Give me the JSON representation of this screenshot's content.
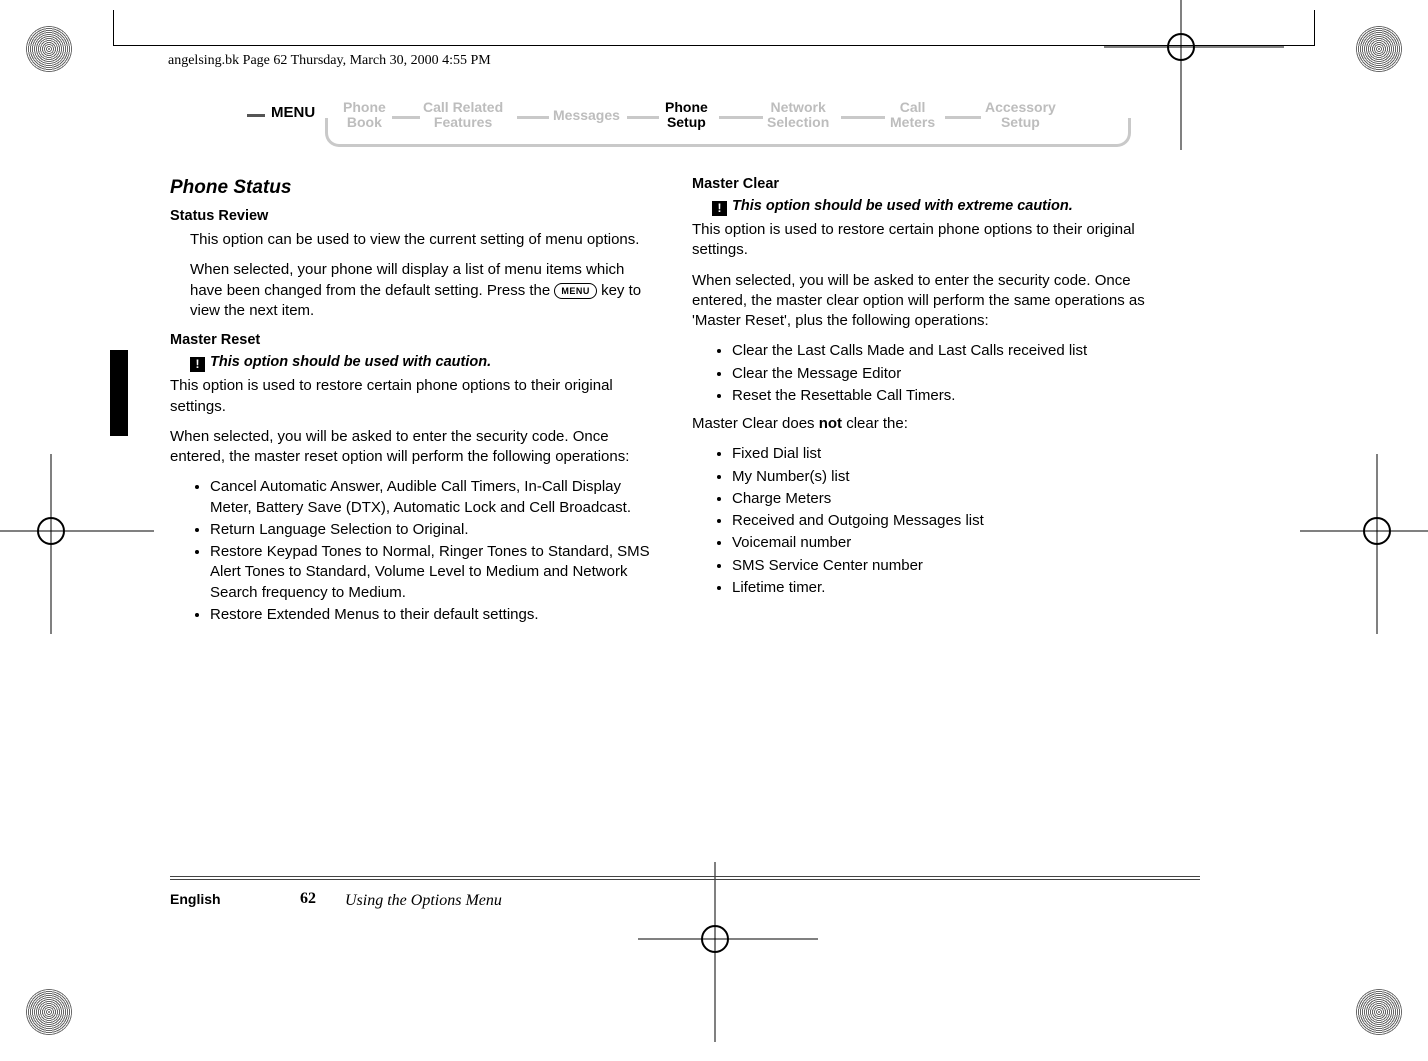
{
  "header_line": "angelsing.bk  Page 62  Thursday, March 30, 2000  4:55 PM",
  "nav": {
    "menu": "MENU",
    "items": [
      {
        "label": "Phone\nBook",
        "active": false
      },
      {
        "label": "Call Related\nFeatures",
        "active": false
      },
      {
        "label": "Messages",
        "active": false
      },
      {
        "label": "Phone\nSetup",
        "active": true
      },
      {
        "label": "Network\nSelection",
        "active": false
      },
      {
        "label": "Call\nMeters",
        "active": false
      },
      {
        "label": "Accessory\nSetup",
        "active": false
      }
    ]
  },
  "left": {
    "h1": "Phone Status",
    "sr_h": "Status Review",
    "sr_p1": "This option can be used to view the current setting of menu options.",
    "sr_p2a": "When selected, your phone will display a list of menu items which have been changed from the default setting. Press the ",
    "sr_key": "MENU",
    "sr_p2b": " key to view the next item.",
    "mr_h": "Master Reset",
    "mr_warn": "This option should be used with caution.",
    "mr_p1": "This option is used to restore certain phone options to their original settings.",
    "mr_p2": "When selected, you will be asked to enter the security code. Once entered, the master reset option will perform the following operations:",
    "mr_li": [
      "Cancel Automatic Answer, Audible Call Timers, In-Call Display Meter, Battery Save (DTX), Automatic Lock and Cell Broadcast.",
      "Return Language Selection to Original.",
      "Restore Keypad Tones to Normal, Ringer Tones to Standard, SMS Alert Tones to Standard, Volume Level to Medium and Network Search frequency to Medium.",
      "Restore Extended Menus to their default settings."
    ]
  },
  "right": {
    "mc_h": "Master Clear",
    "mc_warn": "This option should be used with extreme caution.",
    "mc_p1": "This option is used to restore certain phone options to their original settings.",
    "mc_p2": "When selected, you will be asked to enter the security code. Once entered, the master clear option will perform the same operations as 'Master Reset', plus the following operations:",
    "mc_li": [
      "Clear the Last Calls Made and Last Calls received list",
      "Clear the Message Editor",
      "Reset the Resettable Call Timers."
    ],
    "mc_p3a": "Master Clear does ",
    "mc_p3b": "not",
    "mc_p3c": " clear the:",
    "mc_li2": [
      "Fixed Dial list",
      "My Number(s) list",
      "Charge Meters",
      "Received and Outgoing Messages list",
      "Voicemail number",
      "SMS Service Center number",
      "Lifetime timer."
    ]
  },
  "footer": {
    "lang": "English",
    "page": "62",
    "section": "Using the Options Menu"
  }
}
